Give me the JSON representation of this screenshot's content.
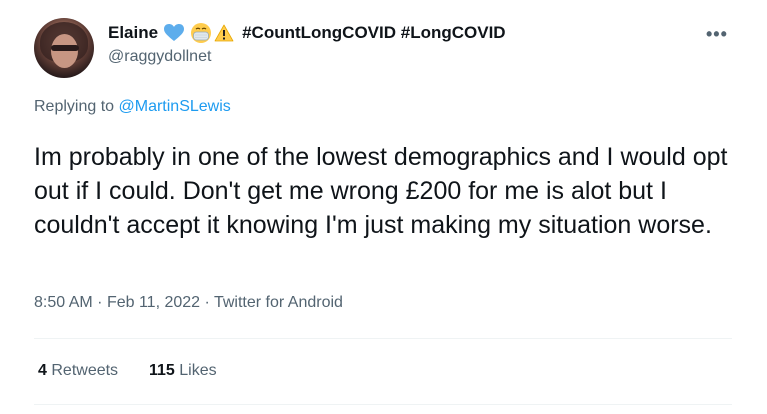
{
  "author": {
    "display_name": "Elaine",
    "hashtags": "#CountLongCOVID #LongCOVID",
    "handle": "@raggydollnet",
    "emoji_icons": [
      "blue-heart-icon",
      "medical-mask-icon",
      "warning-icon"
    ]
  },
  "more_label": "•••",
  "reply_context": {
    "prefix": "Replying to",
    "mention": "@MartinSLewis"
  },
  "tweet": {
    "text": "Im probably in one of the lowest demographics and I would opt out if I could. Don't get me wrong £200 for me is alot but I couldn't accept it knowing I'm just making my situation worse.",
    "time": "8:50 AM",
    "separator": "·",
    "date": "Feb 11, 2022",
    "source": "Twitter for Android"
  },
  "stats": {
    "retweets_count": "4",
    "retweets_label": "Retweets",
    "likes_count": "115",
    "likes_label": "Likes"
  },
  "colors": {
    "text": "#0f1419",
    "secondary": "#536471",
    "link": "#1d9bf0",
    "divider": "#eff3f4"
  }
}
